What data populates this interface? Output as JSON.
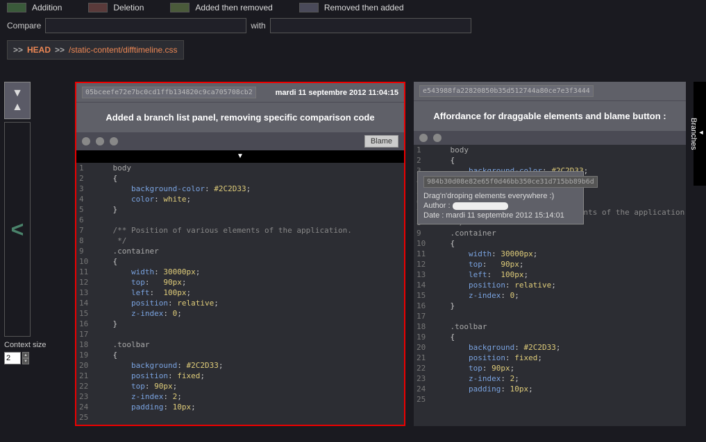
{
  "legend": {
    "addition": "Addition",
    "deletion": "Deletion",
    "add_rem": "Added then removed",
    "rem_add": "Removed then added",
    "colors": {
      "addition": "#3a5a3a",
      "deletion": "#5a3a3a",
      "add_rem": "#4a5a3a",
      "rem_add": "#4a4a5a"
    }
  },
  "compare": {
    "label_left": "Compare",
    "label_with": "with"
  },
  "breadcrumb": {
    "sep": ">>",
    "head": "HEAD",
    "path": "/static-content/difftimeline.css"
  },
  "context": {
    "label": "Context size",
    "value": "2"
  },
  "tooltip": {
    "hash": "984b30d08e82e65f0d46bb350ce31d715bb89b6d",
    "message": "Drag'n'droping elements everywhere :)",
    "author_label": "Author :",
    "date_label": "Date :",
    "date": "mardi 11 septembre 2012 15:14:01"
  },
  "branches_label": "Branches",
  "panels": [
    {
      "hash": "05bceefe72e7bc0cd1ffb134820c9ca705708cb2",
      "date": "mardi 11 septembre 2012 11:04:15",
      "title": "Added a branch list panel, removing specific comparison code",
      "blame": "Blame",
      "dots": 3,
      "show_expand": true
    },
    {
      "hash": "e543988fa22820850b35d512744a80ce7e3f3444",
      "date": "",
      "title": "Affordance for draggable elements and blame button :",
      "blame": "",
      "dots": 2,
      "show_expand": false
    }
  ],
  "code": [
    {
      "n": "1",
      "t": "    body",
      "c": "sel"
    },
    {
      "n": "2",
      "t": "    {",
      "c": ""
    },
    {
      "n": "3",
      "t": "        background-color: #2C2D33;",
      "c": "prop"
    },
    {
      "n": "4",
      "t": "        color: white;",
      "c": "prop"
    },
    {
      "n": "5",
      "t": "    }",
      "c": ""
    },
    {
      "n": "6",
      "t": "",
      "c": ""
    },
    {
      "n": "7",
      "t": "    /** Position of various elements of the application.",
      "c": "comm"
    },
    {
      "n": "8",
      "t": "     */",
      "c": "comm"
    },
    {
      "n": "9",
      "t": "    .container",
      "c": "sel"
    },
    {
      "n": "10",
      "t": "    {",
      "c": ""
    },
    {
      "n": "11",
      "t": "        width: 30000px;",
      "c": "prop"
    },
    {
      "n": "12",
      "t": "        top:   90px;",
      "c": "prop"
    },
    {
      "n": "13",
      "t": "        left:  100px;",
      "c": "prop"
    },
    {
      "n": "14",
      "t": "        position: relative;",
      "c": "prop"
    },
    {
      "n": "15",
      "t": "        z-index: 0;",
      "c": "prop"
    },
    {
      "n": "16",
      "t": "    }",
      "c": ""
    },
    {
      "n": "17",
      "t": "",
      "c": ""
    },
    {
      "n": "18",
      "t": "    .toolbar",
      "c": "sel"
    },
    {
      "n": "19",
      "t": "    {",
      "c": ""
    },
    {
      "n": "20",
      "t": "        background: #2C2D33;",
      "c": "prop"
    },
    {
      "n": "21",
      "t": "        position: fixed;",
      "c": "prop"
    },
    {
      "n": "22",
      "t": "        top: 90px;",
      "c": "prop"
    },
    {
      "n": "23",
      "t": "        z-index: 2;",
      "c": "prop"
    },
    {
      "n": "24",
      "t": "        padding: 10px;",
      "c": "prop"
    },
    {
      "n": "25",
      "t": "",
      "c": ""
    }
  ]
}
